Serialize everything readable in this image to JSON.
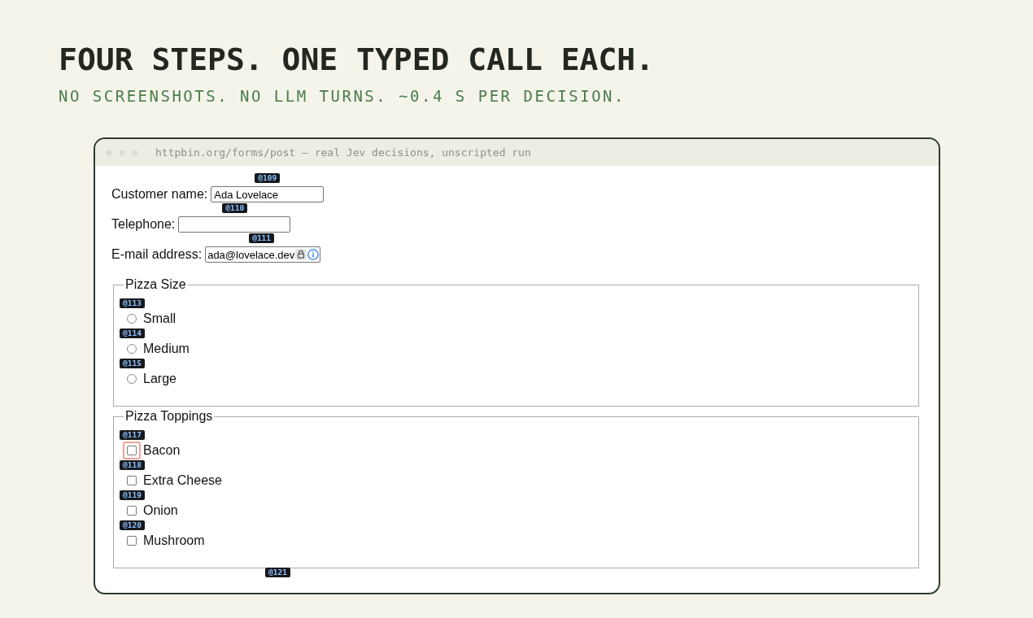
{
  "heading": "FOUR STEPS. ONE TYPED CALL EACH.",
  "subheading": "NO SCREENSHOTS. NO LLM TURNS. ~0.4 S PER DECISION.",
  "window": {
    "title": "httpbin.org/forms/post — real Jev decisions, unscripted run"
  },
  "fields": [
    {
      "kind": "text",
      "label": "Customer name:",
      "value": "Ada Lovelace",
      "tag": "@109"
    },
    {
      "kind": "tel",
      "label": "Telephone:",
      "tag": "@110"
    },
    {
      "kind": "email",
      "label": "E-mail address:",
      "value": "ada@lovelace.dev",
      "tag": "@111"
    }
  ],
  "groups": [
    {
      "kind": "radio",
      "legend": "Pizza Size",
      "options": [
        {
          "label": "Small",
          "tag": "@113",
          "selected": false
        },
        {
          "label": "Medium",
          "tag": "@114",
          "selected": false
        },
        {
          "label": "Large",
          "tag": "@115",
          "selected": false
        }
      ]
    },
    {
      "kind": "checkbox",
      "legend": "Pizza Toppings",
      "options": [
        {
          "label": "Bacon",
          "tag": "@117",
          "checked": false,
          "highlighted": true
        },
        {
          "label": "Extra Cheese",
          "tag": "@118",
          "checked": false,
          "highlighted": false
        },
        {
          "label": "Onion",
          "tag": "@119",
          "checked": false,
          "highlighted": false
        },
        {
          "label": "Mushroom",
          "tag": "@120",
          "checked": false,
          "highlighted": false
        }
      ]
    }
  ],
  "footer_tag": "@121"
}
